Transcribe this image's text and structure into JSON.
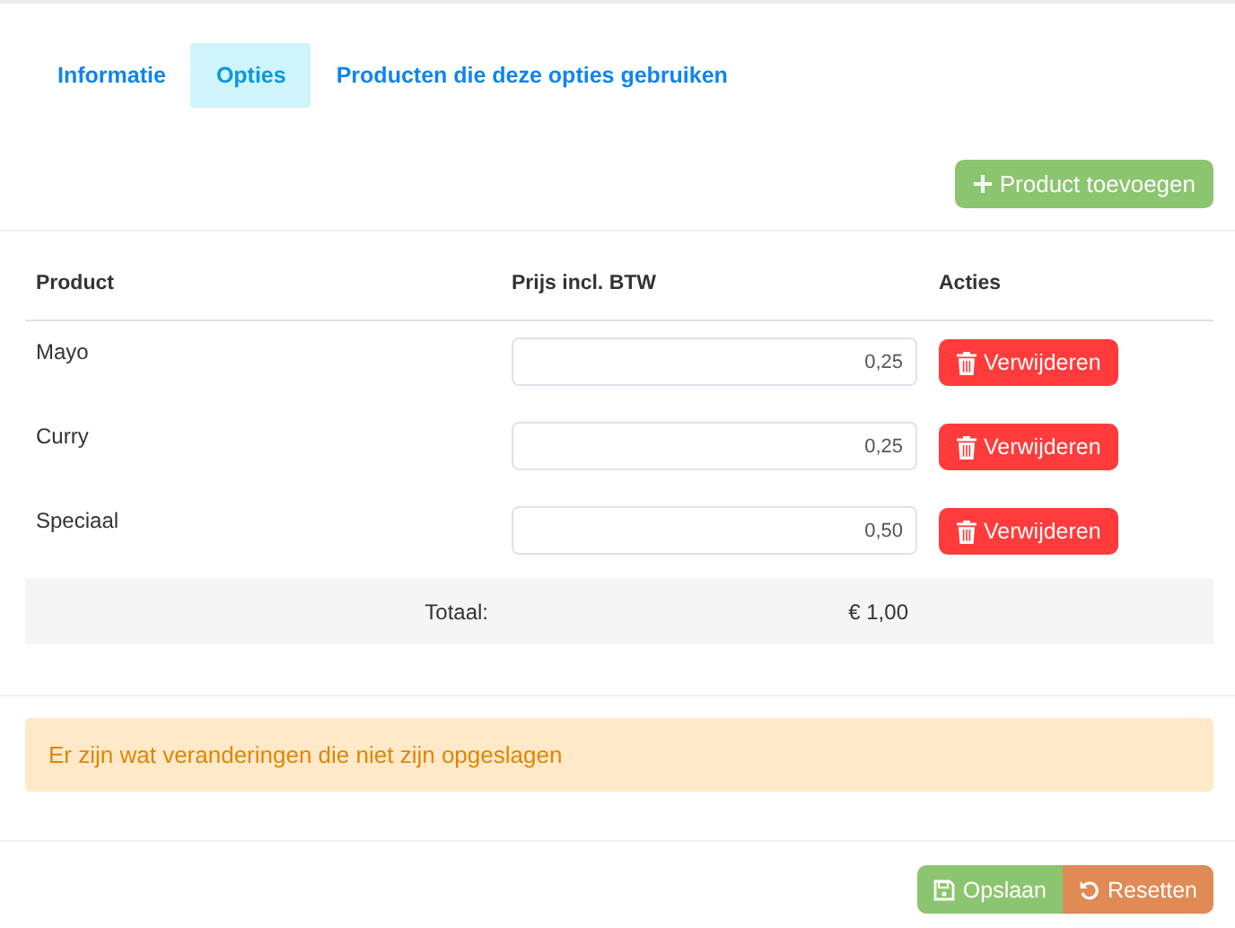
{
  "tabs": [
    {
      "label": "Informatie",
      "selected": false
    },
    {
      "label": "Opties",
      "selected": true
    },
    {
      "label": "Producten die deze opties gebruiken",
      "selected": false
    }
  ],
  "add_button": {
    "label": "Product toevoegen"
  },
  "table": {
    "columns": [
      "Product",
      "Prijs incl. BTW",
      "Acties"
    ],
    "rows": [
      {
        "product": "Mayo",
        "price": "0,25",
        "action": "Verwijderen"
      },
      {
        "product": "Curry",
        "price": "0,25",
        "action": "Verwijderen"
      },
      {
        "product": "Speciaal",
        "price": "0,50",
        "action": "Verwijderen"
      }
    ],
    "total_label": "Totaal:",
    "total_value": "€ 1,00"
  },
  "alert": "Er zijn wat veranderingen die niet zijn opgeslagen",
  "footer_buttons": [
    {
      "kind": "save",
      "label": "Opslaan"
    },
    {
      "kind": "reset",
      "label": "Resetten"
    }
  ]
}
